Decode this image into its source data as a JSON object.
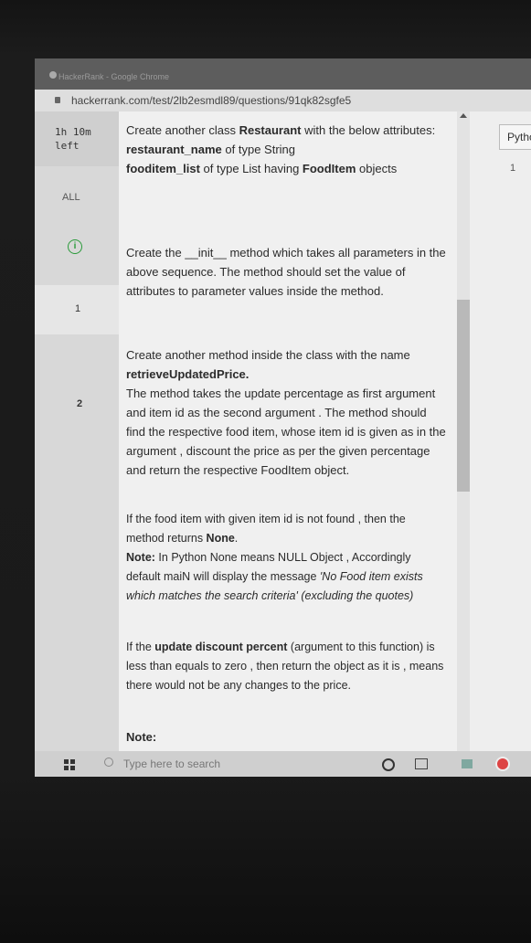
{
  "window": {
    "title": "HackerRank - Google Chrome",
    "url": "hackerrank.com/test/2lb2esmdl89/questions/91qk82sgfe5"
  },
  "sidebar": {
    "timer_line1": "1h 10m",
    "timer_line2": "left",
    "all_label": "ALL",
    "info_icon": "info-circle-icon",
    "questions": [
      "1",
      "2"
    ]
  },
  "problem": {
    "p1_a": "Create another class ",
    "p1_b": "Restaurant",
    "p1_c": " with the below attributes:",
    "p1_attr1_name": "restaurant_name",
    "p1_attr1_rest": " of type String",
    "p1_attr2_name": "fooditem_list",
    "p1_attr2_mid": " of type List having ",
    "p1_attr2_type": "FoodItem",
    "p1_attr2_end": " objects",
    "p2": "Create the __init__ method which takes all parameters in the above sequence. The method should set the value of attributes to parameter values inside the method.",
    "p3_a": "Create another method inside the class with the name ",
    "p3_b": "retrieveUpdatedPrice.",
    "p3_c": "The method takes the update percentage as first argument and item id as the second argument . The method should find the respective food item, whose item id is given as in the argument , discount the price as per the given percentage and return the respective FoodItem object.",
    "p4_a": "If the food item with given item id is not found , then the method returns ",
    "p4_b": "None",
    "p4_c": ".",
    "p4_note": "Note:",
    "p4_d": " In Python None means NULL Object , Accordingly default maiN will display the message ",
    "p4_e": "'No Food item exists which matches the search criteria' (excluding the quotes)",
    "p5_a": "If the ",
    "p5_b": "update discount percent",
    "p5_c": " (argument to this function) is less than equals to zero , then return the object as it is , means there would not be any changes to the price.",
    "p6": "Note:"
  },
  "editor": {
    "language": "Pytho",
    "line_number": "1"
  },
  "taskbar": {
    "search_placeholder": "Type here to search"
  }
}
